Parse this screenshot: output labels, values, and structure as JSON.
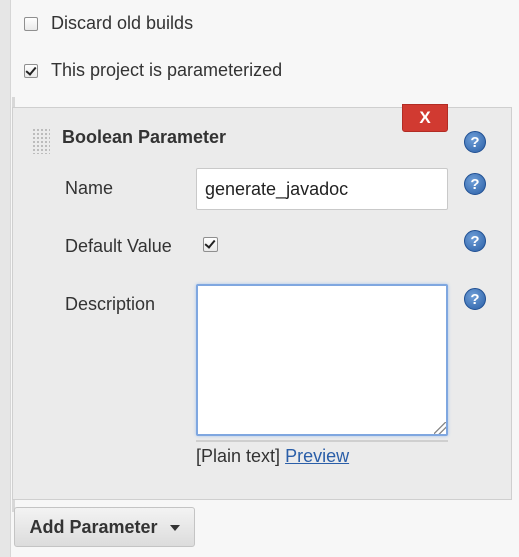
{
  "options": {
    "discard_old_builds": {
      "label": "Discard old builds",
      "checked": false
    },
    "parameterized": {
      "label": "This project is parameterized",
      "checked": true
    }
  },
  "parameter": {
    "title": "Boolean Parameter",
    "delete_label": "X",
    "name_label": "Name",
    "name_value": "generate_javadoc",
    "default_label": "Default Value",
    "default_checked": true,
    "description_label": "Description",
    "description_value": "",
    "format_plain": "[Plain text]",
    "format_preview": "Preview"
  },
  "help": {
    "glyph": "?"
  },
  "buttons": {
    "add_parameter": "Add Parameter"
  },
  "colors": {
    "delete_button": "#d13a31",
    "help_icon": "#2a5fa6",
    "link": "#2a5ea8",
    "focus_border": "#7fa7e0"
  }
}
